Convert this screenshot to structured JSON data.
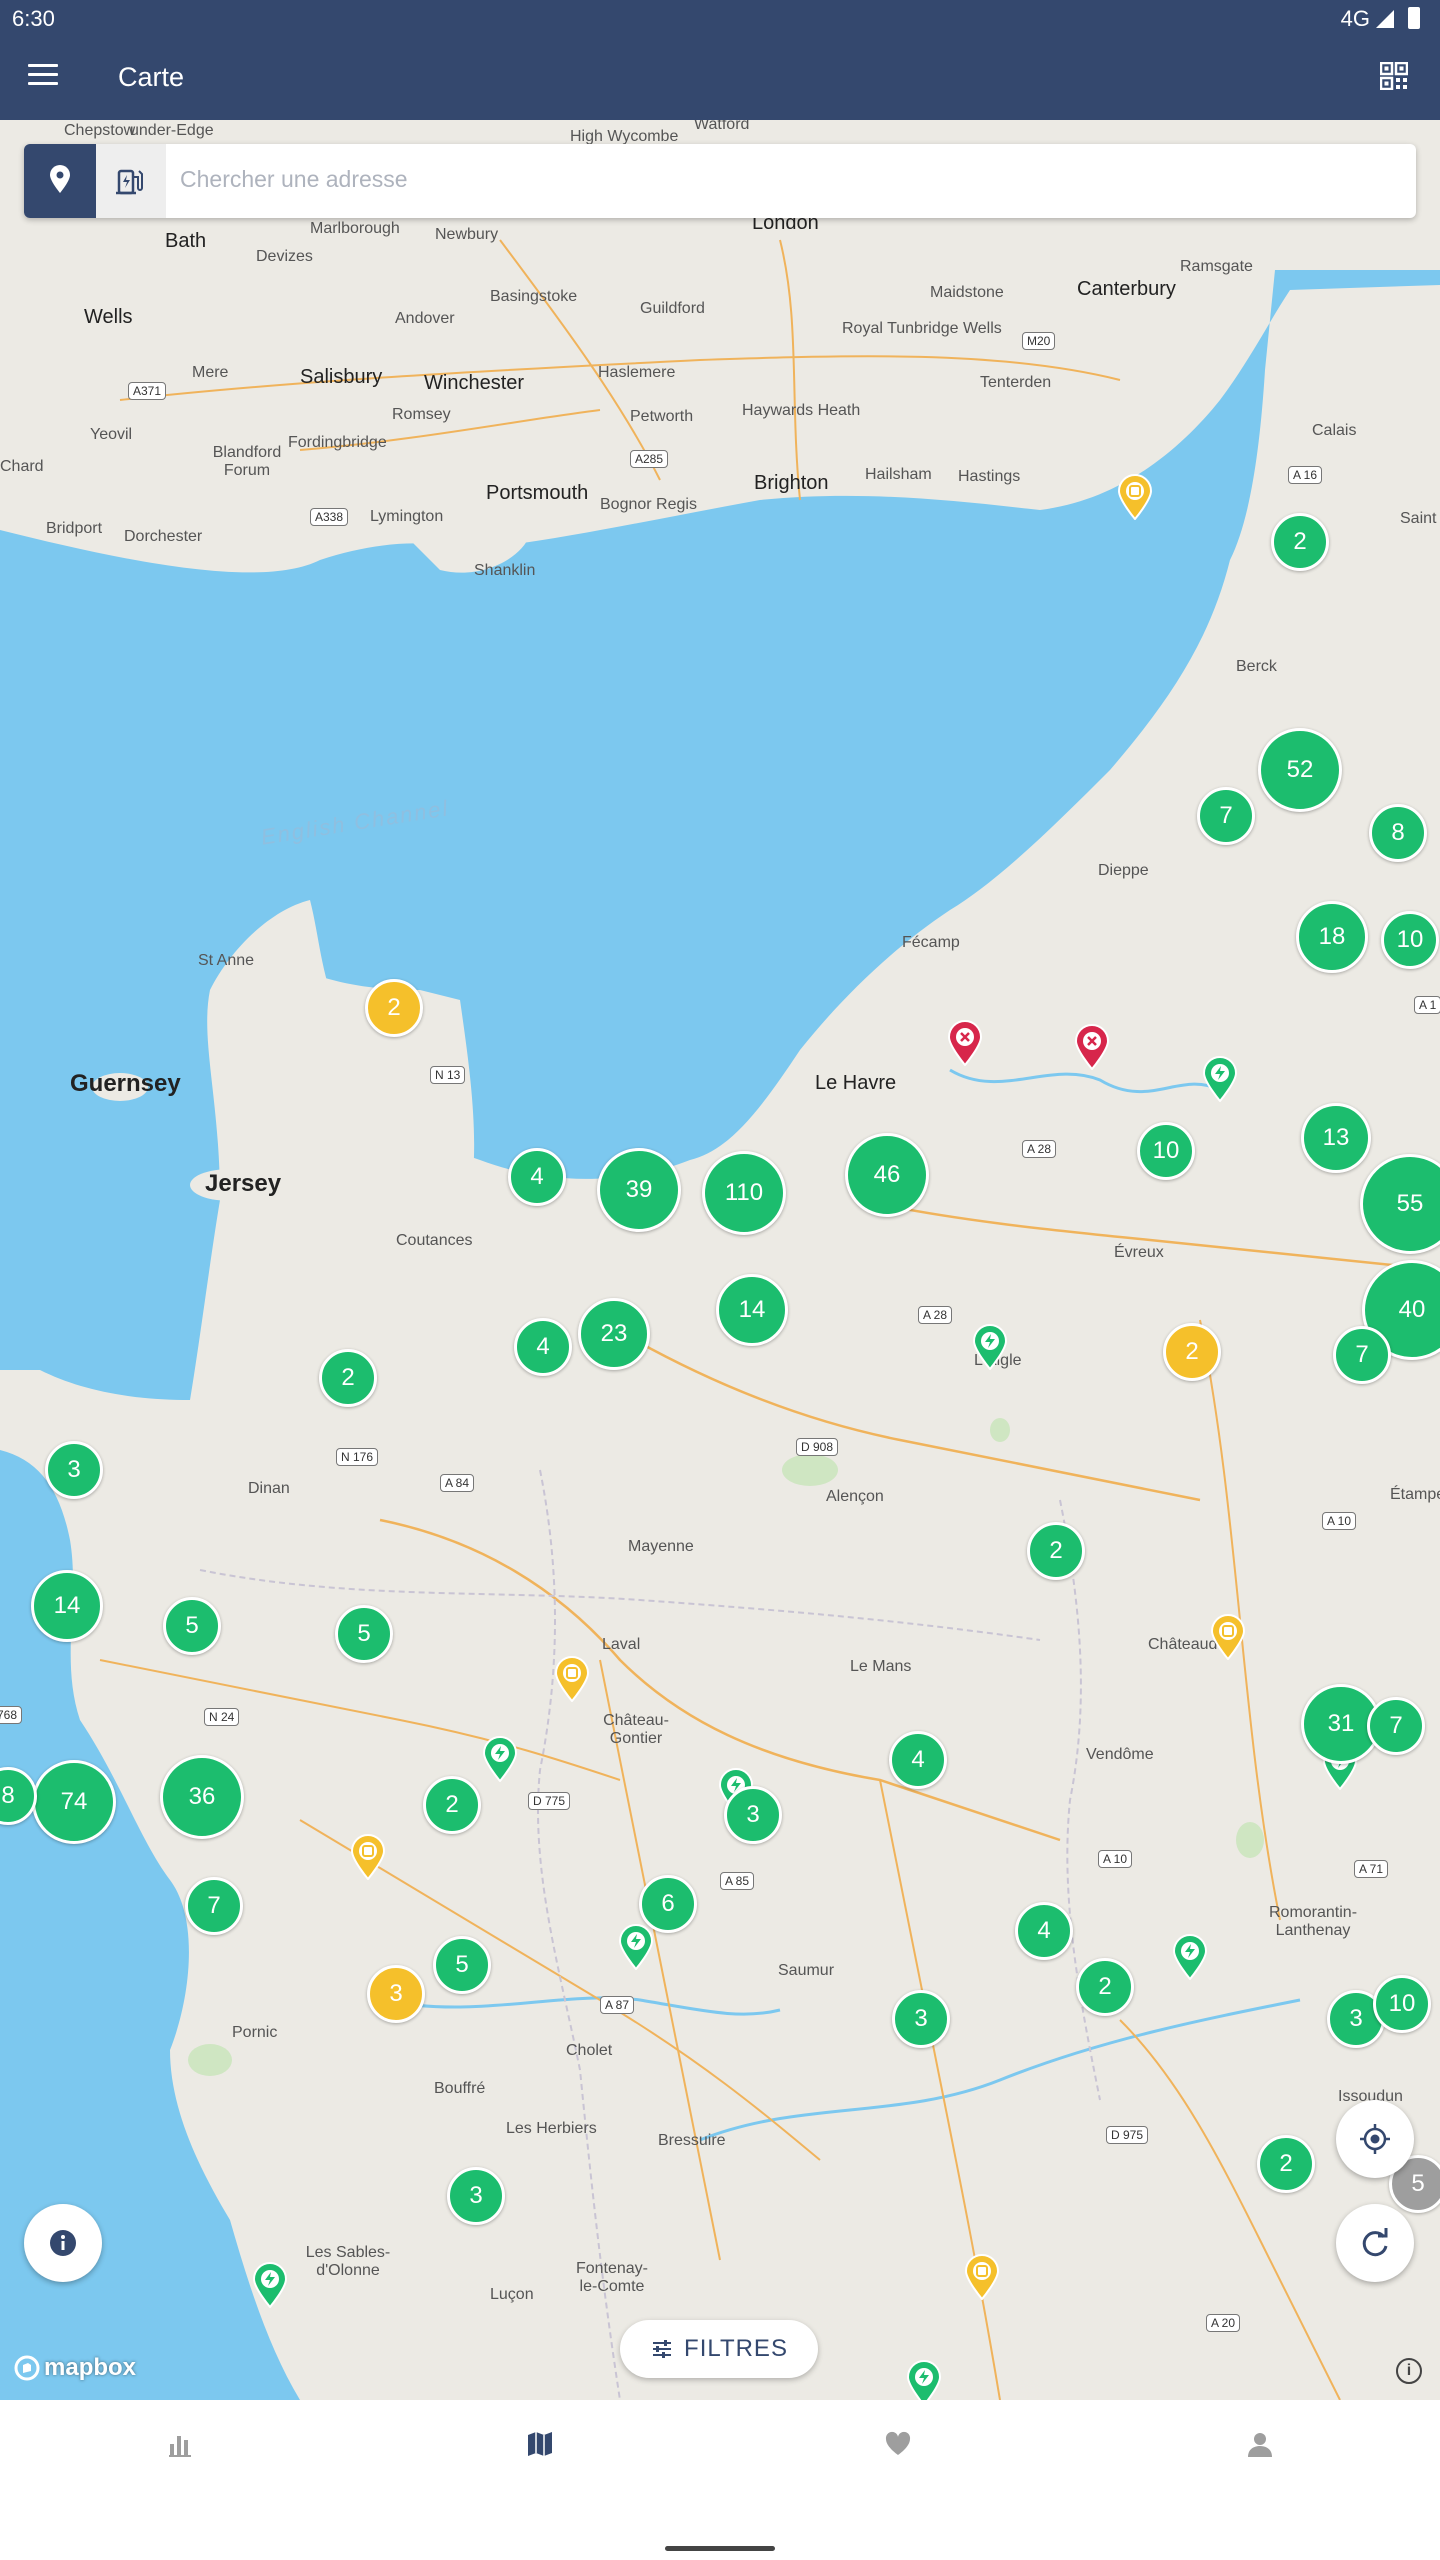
{
  "status_bar": {
    "time": "6:30",
    "network": "4G"
  },
  "app_bar": {
    "title": "Carte"
  },
  "search": {
    "placeholder": "Chercher une adresse"
  },
  "map": {
    "sea_label": "English Channel",
    "island_labels": [
      "Guernsey",
      "Jersey"
    ],
    "place_labels": [
      "Chepstow",
      "under-Edge",
      "High Wycombe",
      "Watford",
      "London",
      "Bath",
      "Marlborough",
      "Newbury",
      "Devizes",
      "Basingstoke",
      "Guildford",
      "Maidstone",
      "Canterbury",
      "Ramsgate",
      "Wells",
      "Andover",
      "Royal Tunbridge Wells",
      "Mere",
      "Salisbury",
      "Winchester",
      "Haslemere",
      "Tenterden",
      "Yeovil",
      "Romsey",
      "Petworth",
      "Haywards Heath",
      "Blandford Forum",
      "Fordingbridge",
      "Hailsham",
      "Hastings",
      "Chard",
      "Portsmouth",
      "Bognor Regis",
      "Brighton",
      "Bridport",
      "Dorchester",
      "Lymington",
      "Shanklin",
      "Calais",
      "Saint",
      "Berck",
      "Dieppe",
      "Fécamp",
      "St Anne",
      "Le Havre",
      "Coutances",
      "Évreux",
      "L'Aigle",
      "Alençon",
      "Dinan",
      "Mayenne",
      "Laval",
      "Le Mans",
      "Châteaudun",
      "Étampe",
      "Château-Gontier",
      "Vendôme",
      "Romorantin-Lanthenay",
      "Saumur",
      "Cholet",
      "Pornic",
      "Bouffré",
      "Les Herbiers",
      "Bressuire",
      "Issoudun",
      "Les Sables-d'Olonne",
      "Luçon",
      "Fontenay-le-Comte"
    ],
    "road_labels": [
      "A371",
      "M20",
      "A285",
      "A338",
      "A 16",
      "A 1",
      "N 13",
      "A 28",
      "A 28",
      "N 176",
      "A 84",
      "D 908",
      "A 10",
      "N 24",
      "D 775",
      "A 85",
      "A 10",
      "A 71",
      "A 87",
      "D 975",
      "A 20",
      "768"
    ],
    "clusters": [
      {
        "count": "52",
        "color": "green"
      },
      {
        "count": "7",
        "color": "green"
      },
      {
        "count": "8",
        "color": "green"
      },
      {
        "count": "18",
        "color": "green"
      },
      {
        "count": "10",
        "color": "green"
      },
      {
        "count": "2",
        "color": "green"
      },
      {
        "count": "2",
        "color": "yellow"
      },
      {
        "count": "4",
        "color": "green"
      },
      {
        "count": "39",
        "color": "green"
      },
      {
        "count": "110",
        "color": "green"
      },
      {
        "count": "46",
        "color": "green"
      },
      {
        "count": "10",
        "color": "green"
      },
      {
        "count": "13",
        "color": "green"
      },
      {
        "count": "55",
        "color": "green"
      },
      {
        "count": "40",
        "color": "green"
      },
      {
        "count": "4",
        "color": "green"
      },
      {
        "count": "23",
        "color": "green"
      },
      {
        "count": "14",
        "color": "green"
      },
      {
        "count": "2",
        "color": "yellow"
      },
      {
        "count": "7",
        "color": "green"
      },
      {
        "count": "2",
        "color": "green"
      },
      {
        "count": "3",
        "color": "green"
      },
      {
        "count": "2",
        "color": "green"
      },
      {
        "count": "14",
        "color": "green"
      },
      {
        "count": "5",
        "color": "green"
      },
      {
        "count": "5",
        "color": "green"
      },
      {
        "count": "31",
        "color": "green"
      },
      {
        "count": "7",
        "color": "green"
      },
      {
        "count": "4",
        "color": "green"
      },
      {
        "count": "74",
        "color": "green"
      },
      {
        "count": "8",
        "color": "green"
      },
      {
        "count": "36",
        "color": "green"
      },
      {
        "count": "2",
        "color": "green"
      },
      {
        "count": "3",
        "color": "green"
      },
      {
        "count": "7",
        "color": "green"
      },
      {
        "count": "6",
        "color": "green"
      },
      {
        "count": "4",
        "color": "green"
      },
      {
        "count": "5",
        "color": "green"
      },
      {
        "count": "3",
        "color": "yellow"
      },
      {
        "count": "2",
        "color": "green"
      },
      {
        "count": "3",
        "color": "green"
      },
      {
        "count": "3",
        "color": "green"
      },
      {
        "count": "10",
        "color": "green"
      },
      {
        "count": "2",
        "color": "green"
      },
      {
        "count": "5",
        "color": "gray"
      },
      {
        "count": "3",
        "color": "green"
      }
    ],
    "attribution": "mapbox"
  },
  "filters_button": {
    "label": "FILTRES"
  },
  "colors": {
    "primary": "#34486e",
    "cluster_green": "#1cbd6e",
    "cluster_yellow": "#f5c02b",
    "marker_red": "#d7264b",
    "water": "#7cc8ef",
    "land": "#eceae4"
  }
}
